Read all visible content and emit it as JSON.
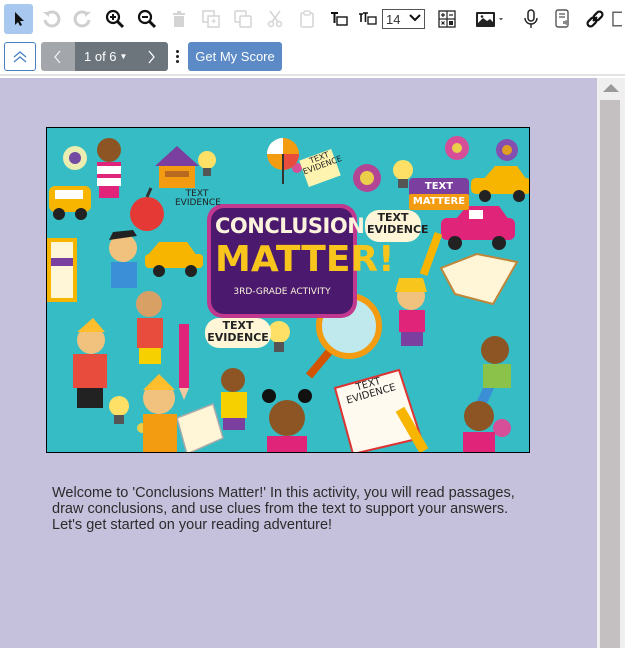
{
  "toolbar": {
    "items": [
      {
        "name": "select-pointer",
        "icon": "cursor-arrow-icon",
        "active": true,
        "enabled": true
      },
      {
        "name": "undo",
        "icon": "undo-icon",
        "enabled": false
      },
      {
        "name": "redo",
        "icon": "redo-icon",
        "enabled": false
      },
      {
        "name": "zoom-in",
        "icon": "zoom-in-icon",
        "enabled": true
      },
      {
        "name": "zoom-out",
        "icon": "zoom-out-icon",
        "enabled": true
      },
      {
        "name": "delete",
        "icon": "trash-icon",
        "enabled": false
      },
      {
        "name": "bring-forward",
        "icon": "bring-forward-icon",
        "enabled": false
      },
      {
        "name": "copy",
        "icon": "copy-icon",
        "enabled": false
      },
      {
        "name": "cut",
        "icon": "scissors-icon",
        "enabled": false
      },
      {
        "name": "paste",
        "icon": "clipboard-icon",
        "enabled": false
      },
      {
        "name": "text-box",
        "icon": "text-box-icon",
        "enabled": true
      },
      {
        "name": "text-resize",
        "icon": "text-resize-icon",
        "enabled": true
      },
      {
        "name": "calculator",
        "icon": "calculator-icon",
        "enabled": true
      },
      {
        "name": "image-insert",
        "icon": "image-icon",
        "enabled": true
      },
      {
        "name": "microphone",
        "icon": "microphone-icon",
        "enabled": true
      },
      {
        "name": "text-to-speech",
        "icon": "speaker-document-icon",
        "enabled": true
      },
      {
        "name": "link",
        "icon": "link-icon",
        "enabled": true
      }
    ],
    "font_size": "14"
  },
  "navbar": {
    "collapse_icon": "double-chevron-up-icon",
    "prev_label": "‹",
    "page_indicator": "1 of 6",
    "next_label": "›",
    "more_icon": "vertical-ellipsis-icon",
    "score_button": "Get My Score"
  },
  "poster": {
    "title_line1": "CONCLUSIONS",
    "title_line2": "MATTER!",
    "subtitle": "3RD-GRADE ACTIVITY",
    "labels": [
      "TEXT EVIDENCE",
      "TEXT EVIDENCE",
      "TEXT MATTERE",
      "TEXT EVIDENCE",
      "TEXT EVIDENCE",
      "TEXT EVIDENCE"
    ]
  },
  "content": {
    "intro_text": "Welcome to 'Conclusions Matter!' In this activity, you will read passages, draw conclusions, and use clues from the text to support your answers. Let's get started on your reading adventure!"
  },
  "colors": {
    "content_background": "#c5c1dc",
    "active_tool": "#a8c8f0",
    "score_button": "#5b8ac7",
    "pager_dark": "#6c747c",
    "pager_disabled": "#a3a6aa",
    "poster_background": "#35bcc4",
    "poster_title_box": "#4b1a6e",
    "poster_title_yellow": "#f7c51c"
  }
}
